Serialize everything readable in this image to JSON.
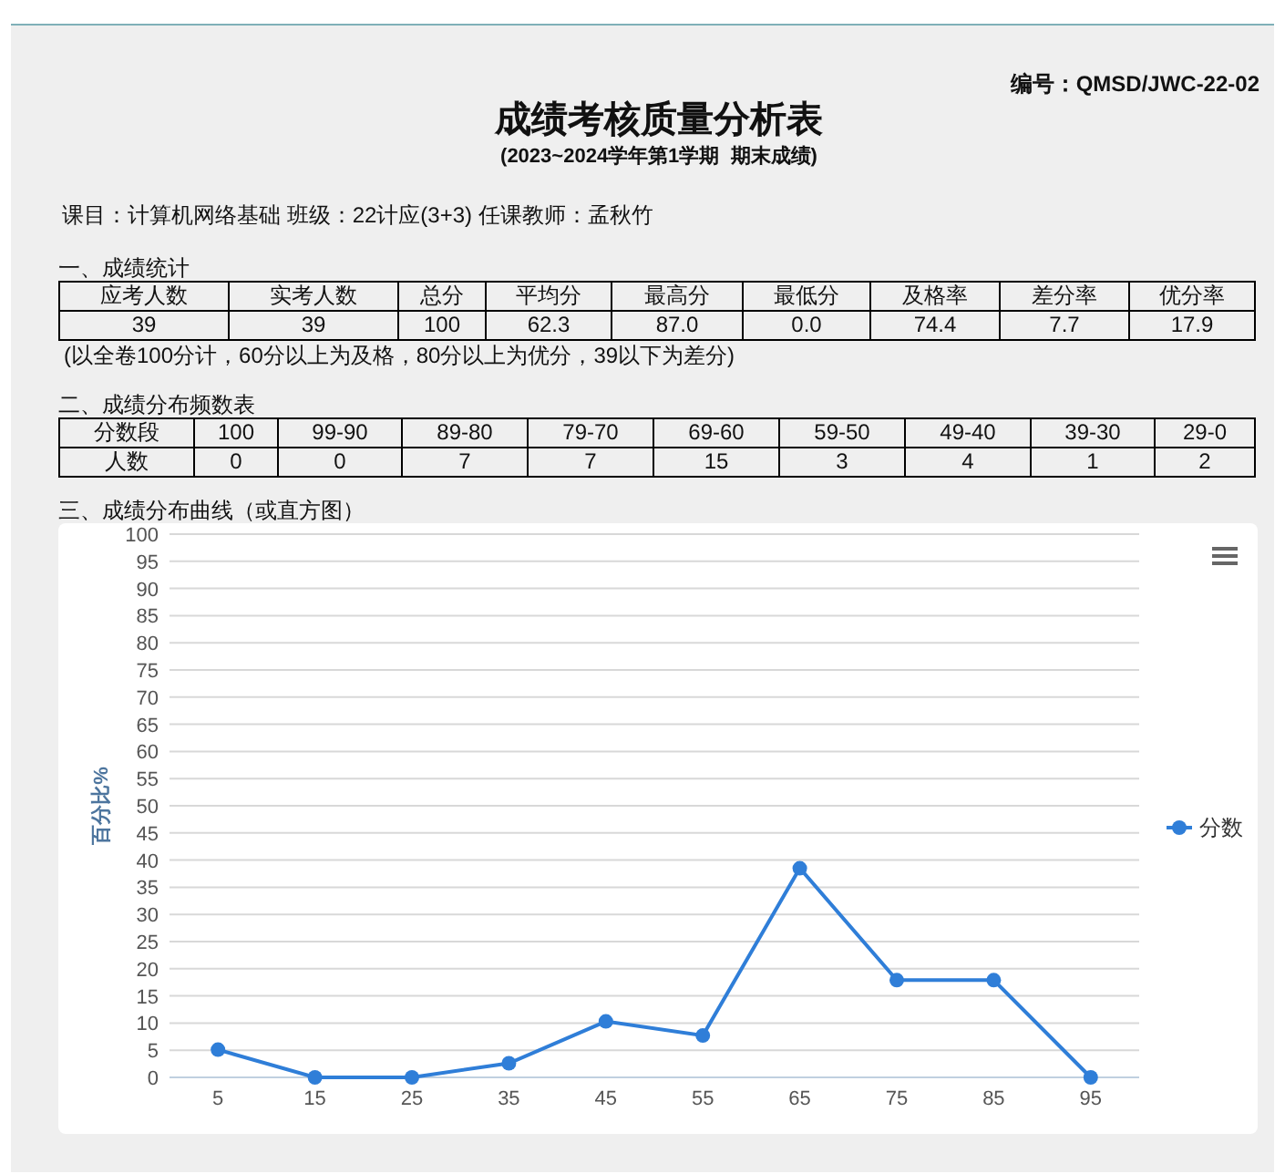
{
  "doc_code": "编号：QMSD/JWC-22-02",
  "title": "成绩考核质量分析表",
  "subtitle": "(2023~2024学年第1学期  期末成绩)",
  "course_info": "课目：计算机网络基础 班级：22计应(3+3) 任课教师：孟秋竹",
  "section_1": {
    "heading": "一、成绩统计",
    "columns": [
      "应考人数",
      "实考人数",
      "总分",
      "平均分",
      "最高分",
      "最低分",
      "及格率",
      "差分率",
      "优分率"
    ],
    "rows": [
      [
        "39",
        "39",
        "100",
        "62.3",
        "87.0",
        "0.0",
        "74.4",
        "7.7",
        "17.9"
      ]
    ],
    "note": "(以全卷100分计，60分以上为及格，80分以上为优分，39以下为差分)"
  },
  "section_2": {
    "heading": "二、成绩分布频数表",
    "rows": [
      [
        "分数段",
        "100",
        "99-90",
        "89-80",
        "79-70",
        "69-60",
        "59-50",
        "49-40",
        "39-30",
        "29-0"
      ],
      [
        "人数",
        "0",
        "0",
        "7",
        "7",
        "15",
        "3",
        "4",
        "1",
        "2"
      ]
    ]
  },
  "section_3": {
    "heading": "三、成绩分布曲线（或直方图）",
    "chart_data": {
      "type": "line",
      "ylabel": "百分比%",
      "categories": [
        "5",
        "15",
        "25",
        "35",
        "45",
        "55",
        "65",
        "75",
        "85",
        "95"
      ],
      "series": [
        {
          "name": "分数",
          "color": "#2f7ed8",
          "marker": "circle",
          "values": [
            5.1,
            0,
            0,
            2.6,
            10.3,
            7.7,
            38.5,
            17.9,
            17.9,
            0
          ]
        }
      ],
      "grid": true,
      "ylim": [
        0,
        100
      ],
      "yticks": [
        0,
        5,
        10,
        15,
        20,
        25,
        30,
        35,
        40,
        45,
        50,
        55,
        60,
        65,
        70,
        75,
        80,
        85,
        90,
        95,
        100
      ]
    }
  }
}
